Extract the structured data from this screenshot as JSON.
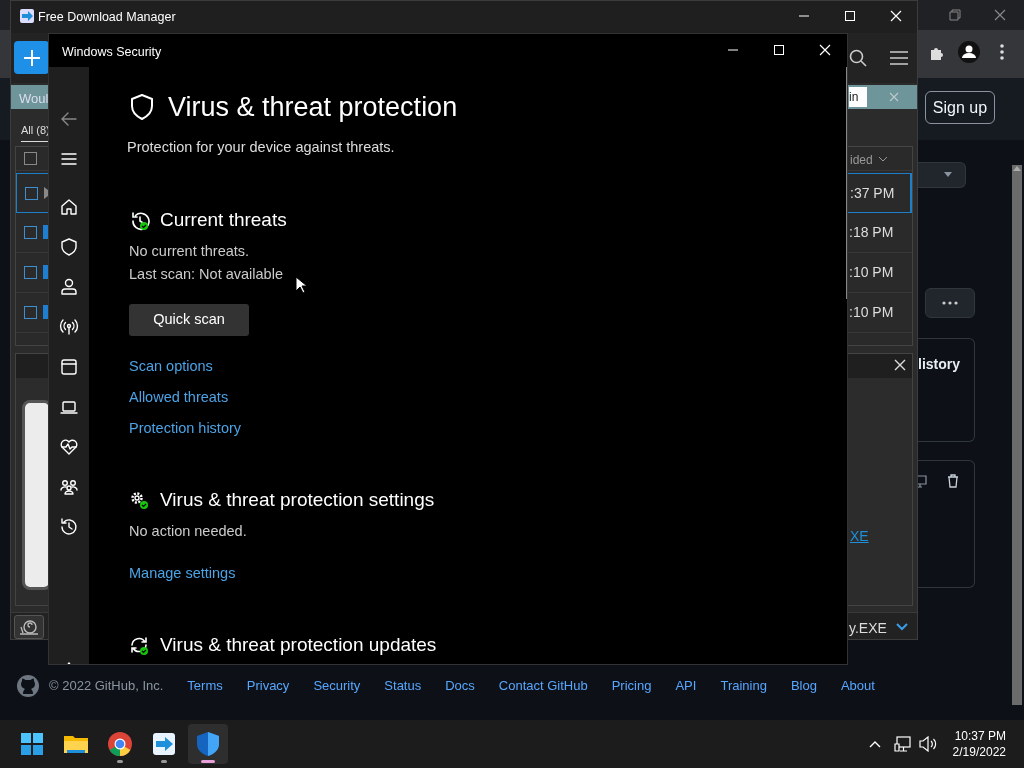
{
  "browser": {
    "sign_up": "Sign up",
    "card_title": "listory",
    "copyright": "© 2022 GitHub, Inc.",
    "footer_links": [
      "Terms",
      "Privacy",
      "Security",
      "Status",
      "Docs",
      "Contact GitHub",
      "Pricing",
      "API",
      "Training",
      "Blog",
      "About"
    ]
  },
  "download_manager": {
    "title": "Free Download Manager",
    "banner_text": "Woul",
    "banner_button": "in",
    "tabs": [
      {
        "label": "All (8)",
        "selected": true
      }
    ],
    "select_all_checked": false,
    "column_header": "ided",
    "rows": [
      {
        "time": ":37 PM",
        "selected": true,
        "checked": false
      },
      {
        "time": ":18 PM",
        "selected": false,
        "checked": false
      },
      {
        "time": ":10 PM",
        "selected": false,
        "checked": false
      },
      {
        "time": ":10 PM",
        "selected": false,
        "checked": false
      }
    ],
    "file_link": "XE",
    "current_file": "y.EXE"
  },
  "windows_security": {
    "title": "Windows Security",
    "heading": "Virus & threat protection",
    "description": "Protection for your device against threats.",
    "sections": [
      {
        "kind": "threats",
        "title": "Current threats",
        "lines": [
          "No current threats.",
          "Last scan: Not available"
        ],
        "button": "Quick scan",
        "links": [
          "Scan options",
          "Allowed threats",
          "Protection history"
        ]
      },
      {
        "kind": "settings",
        "title": "Virus & threat protection settings",
        "lines": [
          "No action needed."
        ],
        "links": [
          "Manage settings"
        ]
      },
      {
        "kind": "updates",
        "title": "Virus & threat protection updates"
      }
    ]
  },
  "taskbar": {
    "apps": [
      {
        "kind": "start",
        "running": false,
        "selected": false
      },
      {
        "kind": "folder",
        "running": false,
        "selected": false
      },
      {
        "kind": "browser",
        "running": true,
        "selected": false
      },
      {
        "kind": "download",
        "running": true,
        "selected": false
      },
      {
        "kind": "shield",
        "running": true,
        "selected": true
      }
    ],
    "time": "10:37 PM",
    "date": "2/19/2022"
  }
}
